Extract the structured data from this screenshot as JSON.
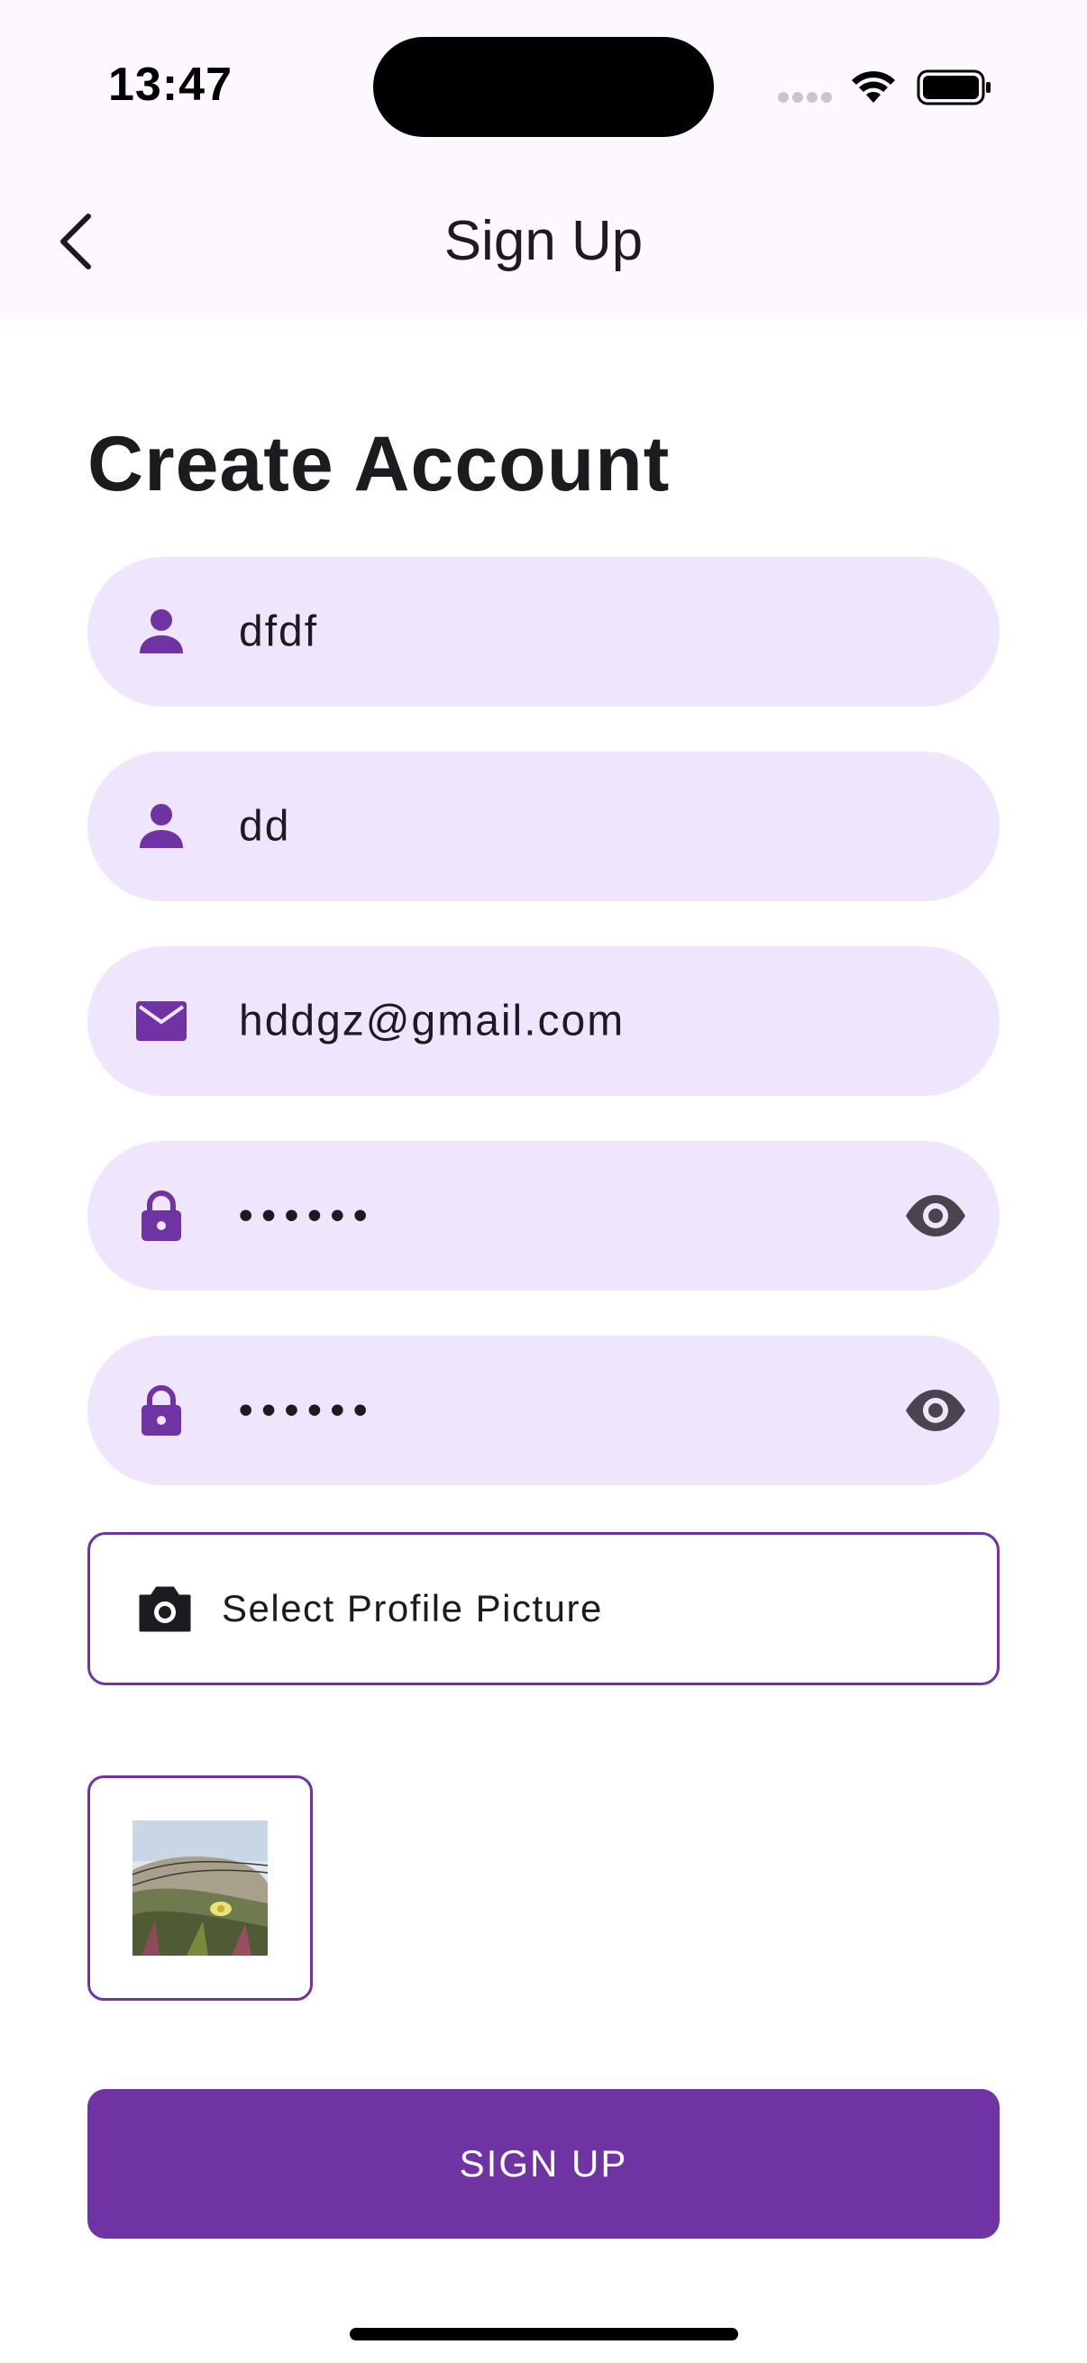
{
  "status_bar": {
    "time": "13:47"
  },
  "app_bar": {
    "title": "Sign Up"
  },
  "form": {
    "heading": "Create Account",
    "first_name_value": "dfdf",
    "last_name_value": "dd",
    "email_value": "hddgz@gmail.com",
    "password_value": "••••••",
    "confirm_password_value": "••••••",
    "select_picture_label": "Select Profile Picture",
    "submit_label": "SIGN UP"
  },
  "colors": {
    "accent": "#6f33a3",
    "field_fill": "#efe5fc",
    "appbar_bg": "#fdf7ff",
    "text": "#1d1b20"
  },
  "icons": {
    "back": "chevron-left-icon",
    "person": "person-icon",
    "email": "mail-icon",
    "lock": "lock-icon",
    "visibility": "eye-icon",
    "camera": "camera-icon"
  }
}
